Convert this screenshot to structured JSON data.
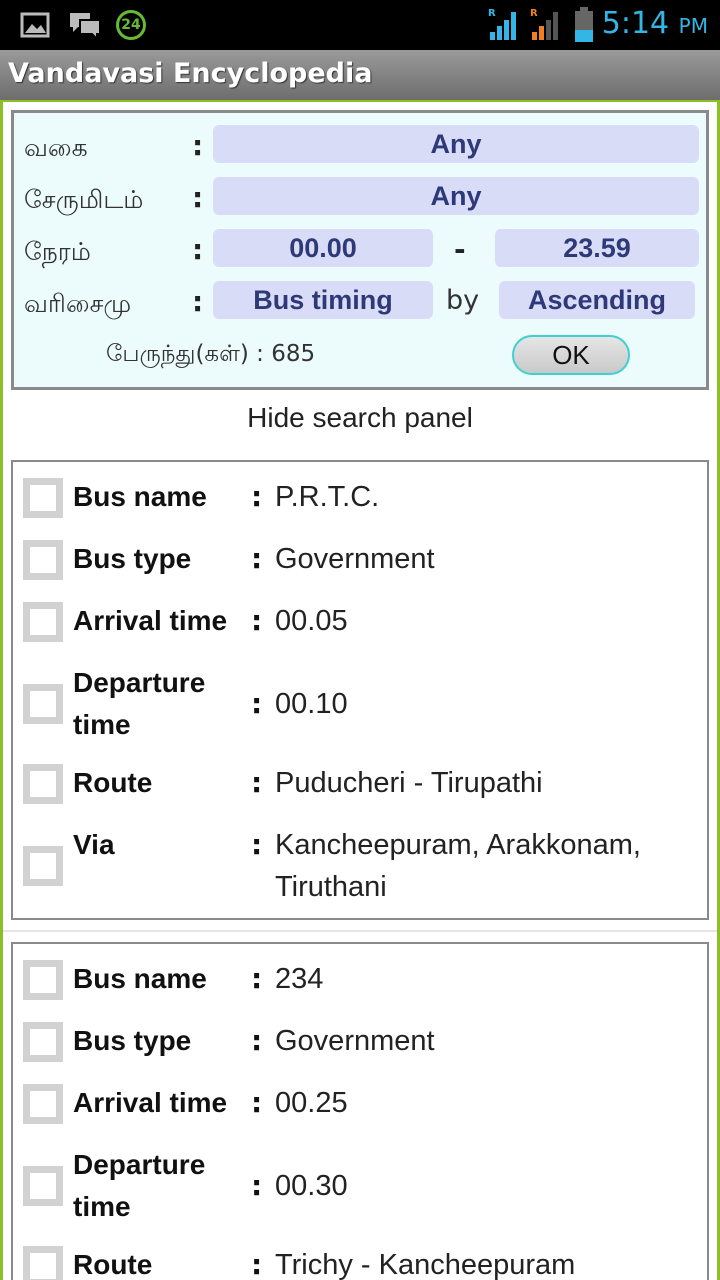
{
  "status_bar": {
    "notif_count": "24",
    "time": "5:14",
    "ampm": "PM",
    "icons": [
      "image-icon",
      "chat-icon",
      "notification-24-icon",
      "signal-r-icon",
      "signal-r2-icon",
      "battery-icon"
    ]
  },
  "app": {
    "title": "Vandavasi Encyclopedia"
  },
  "search": {
    "type_label": "வகை",
    "type_value": "Any",
    "dest_label": "சேருமிடம்",
    "dest_value": "Any",
    "time_label": "நேரம்",
    "time_from": "00.00",
    "time_sep": "-",
    "time_to": "23.59",
    "sort_label": "வரிசைமு",
    "sort_field": "Bus timing",
    "by": "by",
    "sort_order": "Ascending",
    "colon": ":",
    "count_text": "பேருந்து(கள்) : 685",
    "ok_label": "OK"
  },
  "hide_panel_label": "Hide search panel",
  "labels": {
    "bus_name": "Bus name",
    "bus_type": "Bus type",
    "arrival": "Arrival time",
    "departure": "Departure time",
    "route": "Route",
    "via": "Via",
    "colon": ":"
  },
  "buses": [
    {
      "name": "P.R.T.C.",
      "type": "Government",
      "arrival": "00.05",
      "departure": "00.10",
      "route": "Puducheri - Tirupathi",
      "via": "Kancheepuram, Arakkonam, Tiruthani"
    },
    {
      "name": "234",
      "type": "Government",
      "arrival": "00.25",
      "departure": "00.30",
      "route": "Trichy - Kancheepuram"
    }
  ]
}
